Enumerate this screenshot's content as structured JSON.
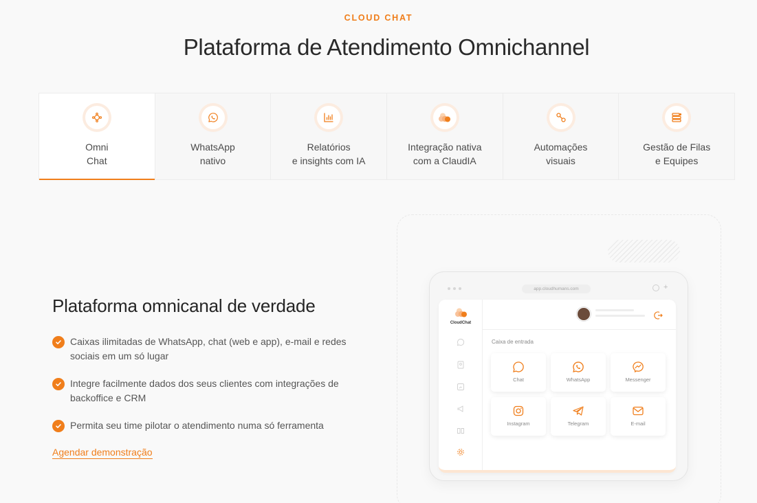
{
  "section": {
    "eyebrow": "CLOUD CHAT",
    "title": "Plataforma de Atendimento Omnichannel"
  },
  "tabs": [
    {
      "label": "Omni\nChat",
      "icon": "omnichannel-icon",
      "active": true
    },
    {
      "label": "WhatsApp\nnativo",
      "icon": "whatsapp-icon",
      "active": false
    },
    {
      "label": "Relatórios\ne insights com IA",
      "icon": "bar-chart-icon",
      "active": false
    },
    {
      "label": "Integração nativa\ncom a ClaudIA",
      "icon": "cloudia-logo-icon",
      "active": false
    },
    {
      "label": "Automações\nvisuais",
      "icon": "flow-icon",
      "active": false
    },
    {
      "label": "Gestão de Filas\ne Equipes",
      "icon": "queue-icon",
      "active": false
    }
  ],
  "content": {
    "heading": "Plataforma omnicanal de verdade",
    "bullets": [
      "Caixas ilimitadas de WhatsApp, chat (web e app), e-mail e redes sociais em um só lugar",
      "Integre facilmente dados dos seus clientes com integrações de backoffice e CRM",
      "Permita seu time pilotar o atendimento numa só ferramenta"
    ],
    "cta": "Agendar demonstração"
  },
  "mockup": {
    "url": "app.cloudhumans.com",
    "brand": "CloudChat",
    "inbox_label": "Caixa de entrada",
    "channels": [
      {
        "label": "Chat",
        "icon": "chat-bubble-icon"
      },
      {
        "label": "WhatsApp",
        "icon": "whatsapp-icon"
      },
      {
        "label": "Messenger",
        "icon": "messenger-icon"
      },
      {
        "label": "Instagram",
        "icon": "instagram-icon"
      },
      {
        "label": "Telegram",
        "icon": "telegram-icon"
      },
      {
        "label": "E-mail",
        "icon": "mail-icon"
      }
    ]
  },
  "colors": {
    "accent": "#f07e1b",
    "background": "#f9f9f9"
  }
}
